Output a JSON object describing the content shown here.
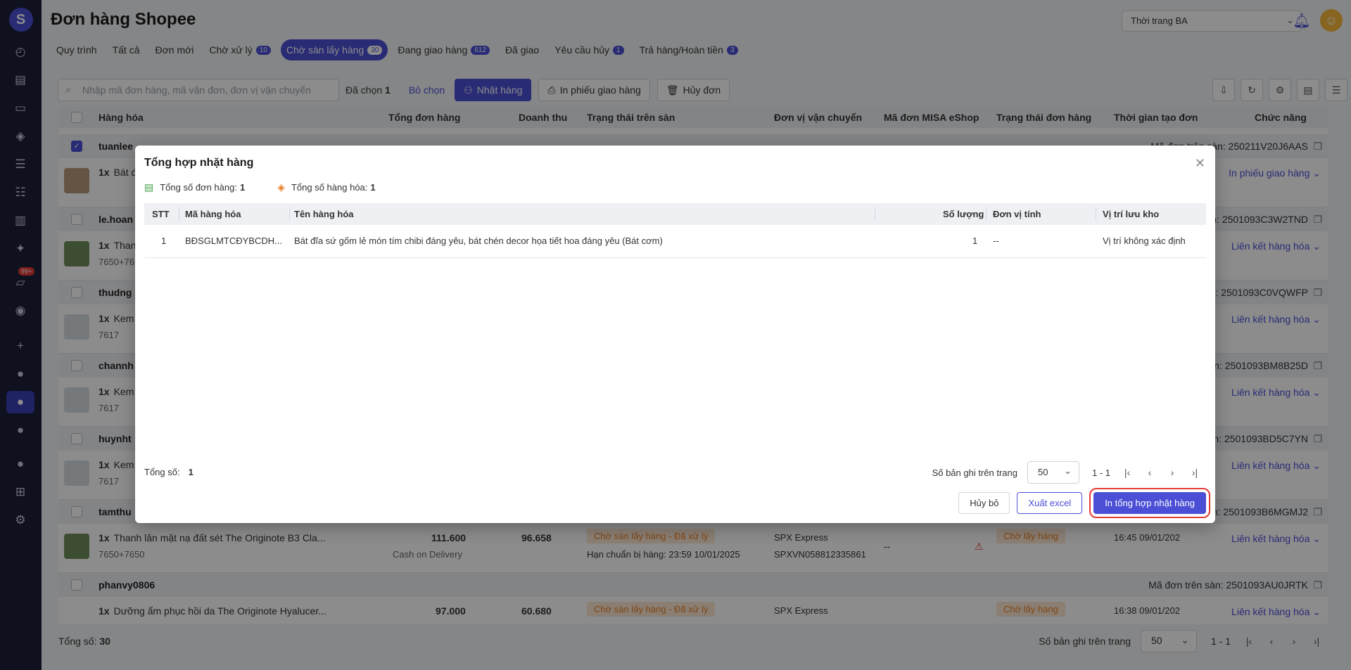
{
  "page": {
    "title": "Đơn hàng Shopee",
    "shop_select": "Thời trang BA"
  },
  "colors": {
    "accent": "#4b4fd6",
    "sidebar": "#1d2039",
    "warning": "#e67e22",
    "highlight": "#e53935"
  },
  "sidebar": {
    "chat_badge": "99+"
  },
  "tabs": [
    {
      "label": "Quy trình",
      "count": ""
    },
    {
      "label": "Tất cả",
      "count": ""
    },
    {
      "label": "Đơn mới",
      "count": ""
    },
    {
      "label": "Chờ xử lý",
      "count": "10"
    },
    {
      "label": "Chờ sàn lấy hàng",
      "count": "30"
    },
    {
      "label": "Đang giao hàng",
      "count": "612"
    },
    {
      "label": "Đã giao",
      "count": ""
    },
    {
      "label": "Yêu cầu hủy",
      "count": "1"
    },
    {
      "label": "Trả hàng/Hoàn tiền",
      "count": "3"
    }
  ],
  "toolbar": {
    "search_placeholder": "Nhập mã đơn hàng, mã vận đơn, đơn vị vận chuyển",
    "selected_label": "Đã chọn",
    "selected_count": "1",
    "deselect": "Bỏ chọn",
    "pick": "Nhặt hàng",
    "print_delivery": "In phiếu giao hàng",
    "cancel_order": "Hủy đơn"
  },
  "table": {
    "headers": [
      "Hàng hóa",
      "Tổng đơn hàng",
      "Doanh thu",
      "Trạng thái trên sàn",
      "Đơn vị vận chuyển",
      "Mã đơn MISA eShop",
      "Trạng thái đơn hàng",
      "Thời gian tạo đơn",
      "Chức năng"
    ],
    "code_prefix": "Mã đơn trên sàn:",
    "rows": [
      {
        "buyer": "tuanlee",
        "code": "250211V20J6AAS",
        "qty": "1x",
        "item": "Bát đ",
        "sub": "",
        "action": "In phiếu giao hàng",
        "checked": true
      },
      {
        "buyer": "le.hoan",
        "code": "2501093C3W2TND",
        "qty": "1x",
        "item": "Than",
        "sub": "7650+76",
        "action": "Liên kết hàng hóa",
        "checked": false
      },
      {
        "buyer": "thudng",
        "code": "2501093C0VQWFP",
        "qty": "1x",
        "item": "Kem",
        "sub": "7617",
        "action": "Liên kết hàng hóa",
        "checked": false
      },
      {
        "buyer": "channh",
        "code": "2501093BM8B25D",
        "qty": "1x",
        "item": "Kem",
        "sub": "7617",
        "action": "Liên kết hàng hóa",
        "checked": false
      },
      {
        "buyer": "huynht",
        "code": "2501093BD5C7YN",
        "qty": "1x",
        "item": "Kem",
        "sub": "7617",
        "action": "Liên kết hàng hóa",
        "checked": false
      },
      {
        "buyer": "tamthu",
        "code": "2501093B6MGMJ2",
        "qty": "1x",
        "item": "Thanh lăn mặt nạ đất sét The Originote B3 Cla...",
        "sub": "7650+7650",
        "total": "111.600",
        "payment": "Cash on Delivery",
        "revenue": "96.658",
        "platform_status": "Chờ sàn lấy hàng - Đã xử lý",
        "deadline": "Hạn chuẩn bị hàng: 23:59 10/01/2025",
        "carrier": "SPX Express",
        "tracking": "SPXVN058812335861",
        "misa": "--",
        "order_status": "Chờ lấy hàng",
        "created": "16:45 09/01/202",
        "action": "Liên kết hàng hóa",
        "checked": false
      },
      {
        "buyer": "phanvy0806",
        "code": "2501093AU0JRTK",
        "qty": "1x",
        "item": "Dưỡng ẩm phục hồi da The Originote Hyalucer...",
        "sub": "",
        "total": "97.000",
        "revenue": "60.680",
        "platform_status": "Chờ sàn lấy hàng - Đã xử lý",
        "carrier": "SPX Express",
        "order_status": "Chờ lấy hàng",
        "created": "16:38 09/01/202",
        "action": "Liên kết hàng hóa",
        "checked": false
      }
    ]
  },
  "footer": {
    "total_label": "Tổng số:",
    "total_value": "30",
    "per_page_label": "Số bản ghi trên trang",
    "per_page_value": "50",
    "range": "1 - 1"
  },
  "modal": {
    "title": "Tổng hợp nhặt hàng",
    "stat_orders_label": "Tổng số đơn hàng:",
    "stat_orders_value": "1",
    "stat_items_label": "Tổng số hàng hóa:",
    "stat_items_value": "1",
    "headers": [
      "STT",
      "Mã hàng hóa",
      "Tên hàng hóa",
      "Số lượng",
      "Đơn vị tính",
      "Vị trí lưu kho"
    ],
    "rows": [
      {
        "stt": "1",
        "sku": "BĐSGLMTCĐYBCDH...",
        "name": "Bát đĩa sứ gốm lẻ món tím chibi đáng yêu, bát chén decor họa tiết hoa đáng yêu (Bát cơm)",
        "qty": "1",
        "unit": "--",
        "location": "Vị trí không xác định"
      }
    ],
    "total_label": "Tổng số:",
    "total_value": "1",
    "per_page_label": "Số bản ghi trên trang",
    "per_page_value": "50",
    "range": "1 - 1",
    "btn_cancel": "Hủy bỏ",
    "btn_export": "Xuất excel",
    "btn_print": "In tổng hợp nhặt hàng"
  }
}
